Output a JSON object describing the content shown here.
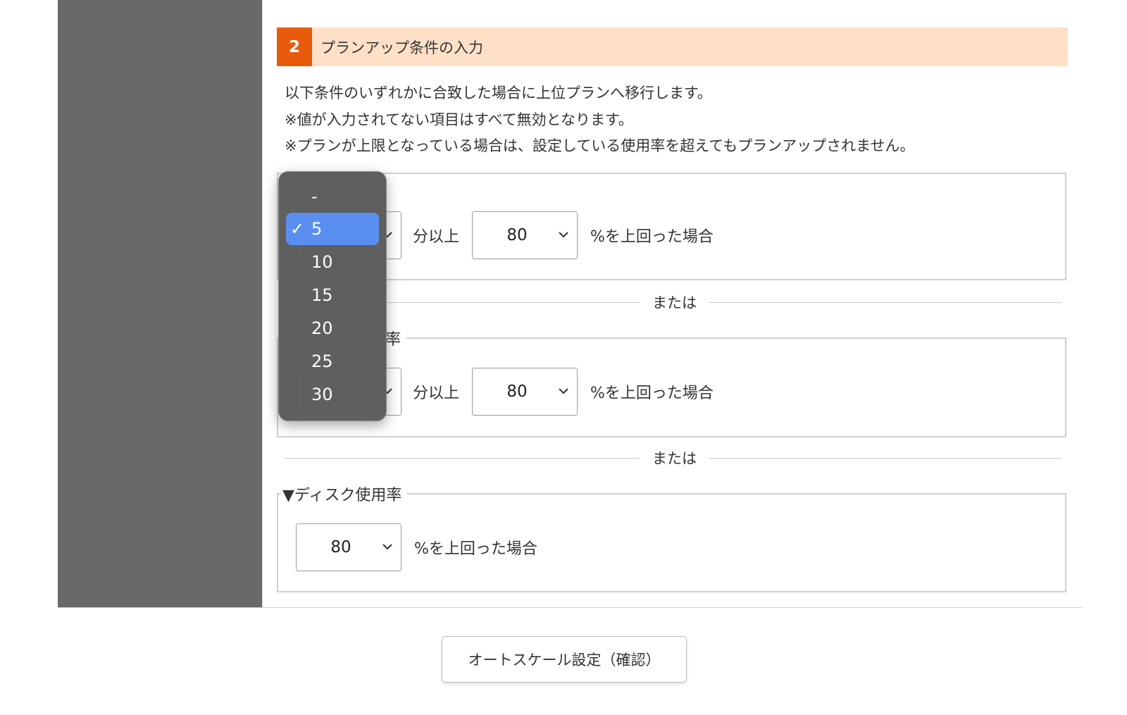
{
  "section": {
    "number": "2",
    "title": "プランアップ条件の入力"
  },
  "description": [
    "以下条件のいずれかに合致した場合に上位プランへ移行します。",
    "※値が入力されてない項目はすべて無効となります。",
    "※プランが上限となっている場合は、設定している使用率を超えてもプランアップされません。"
  ],
  "condition1": {
    "legend": "",
    "duration_suffix": "分以上",
    "rate_value": "80",
    "rate_suffix": "%を上回った場合"
  },
  "or_label": "または",
  "condition2": {
    "legend": "率",
    "duration_suffix": "分以上",
    "rate_value": "80",
    "rate_suffix": "%を上回った場合"
  },
  "condition3": {
    "legend": "▼ディスク使用率",
    "rate_value": "80",
    "rate_suffix": "%を上回った場合"
  },
  "dropdown": {
    "options": [
      "-",
      "5",
      "10",
      "15",
      "20",
      "25",
      "30"
    ],
    "selected": "5",
    "check_mark": "✓"
  },
  "confirm_button": "オートスケール設定（確認）",
  "colors": {
    "sidebar": "#696969",
    "section_header_bg": "#fee0c7",
    "section_number_bg": "#e85a0c",
    "selected_option": "#5a8ff0"
  }
}
